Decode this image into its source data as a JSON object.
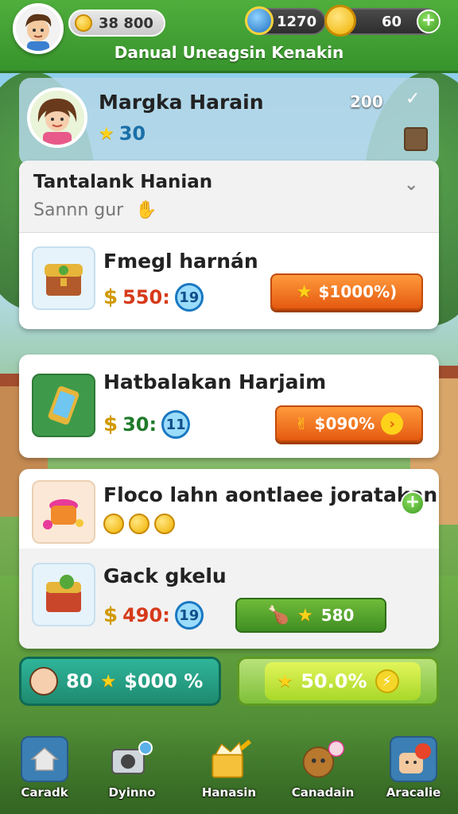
{
  "topbar": {
    "coins": "38 800",
    "gems": "1270",
    "energy": "60",
    "title": "Danual Uneagsin Kenakin"
  },
  "profile": {
    "name": "Margka Harain",
    "stars": "30",
    "level": "200"
  },
  "section": {
    "title": "Tantalank Hanian",
    "subtitle": "Sannn gur"
  },
  "items": [
    {
      "title": "Fmegl harnán",
      "price": "550:",
      "badge": "19",
      "button": "$1000%)"
    },
    {
      "title": "Hatbalakan Harjaim",
      "price": "30:",
      "badge": "11",
      "button": "$090%"
    },
    {
      "title": "Floco lahn aontlaee joratakan"
    },
    {
      "title": "Gack gkelu",
      "price": "490:",
      "badge": "19",
      "button": "580"
    }
  ],
  "actions": {
    "left": {
      "count": "80",
      "value": "$000 %"
    },
    "right": {
      "value": "50.0%"
    }
  },
  "nav": [
    {
      "label": "Caradk",
      "icon": "home-icon"
    },
    {
      "label": "Dyinno",
      "icon": "camera-icon"
    },
    {
      "label": "Hanasin",
      "icon": "box-icon"
    },
    {
      "label": "Canadain",
      "icon": "character-icon"
    },
    {
      "label": "Aracalie",
      "icon": "chat-icon"
    }
  ],
  "colors": {
    "primary_green": "#37932c",
    "orange": "#e55a10",
    "badge_blue": "#1a78c2",
    "gold": "#f0b000"
  }
}
